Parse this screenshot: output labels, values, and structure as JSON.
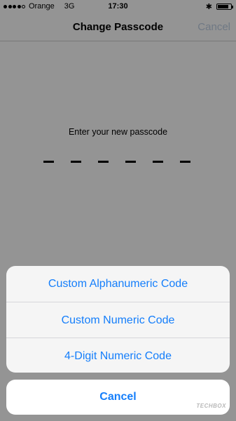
{
  "status_bar": {
    "carrier": "Orange",
    "network": "3G",
    "time": "17:30",
    "battery_level": 0.85,
    "icons": [
      "signal-dots",
      "bluetooth-icon",
      "battery-icon"
    ]
  },
  "nav": {
    "title": "Change Passcode",
    "cancel_label": "Cancel"
  },
  "passcode": {
    "prompt": "Enter your new passcode",
    "digits": 6
  },
  "action_sheet": {
    "options": [
      {
        "label": "Custom Alphanumeric Code"
      },
      {
        "label": "Custom Numeric Code"
      },
      {
        "label": "4-Digit Numeric Code"
      }
    ],
    "cancel_label": "Cancel"
  },
  "watermark": "TECHBOX",
  "colors": {
    "accent": "#147efb",
    "disabled_nav": "#b9c9dc",
    "overlay": "rgba(0,0,0,0.40)"
  }
}
